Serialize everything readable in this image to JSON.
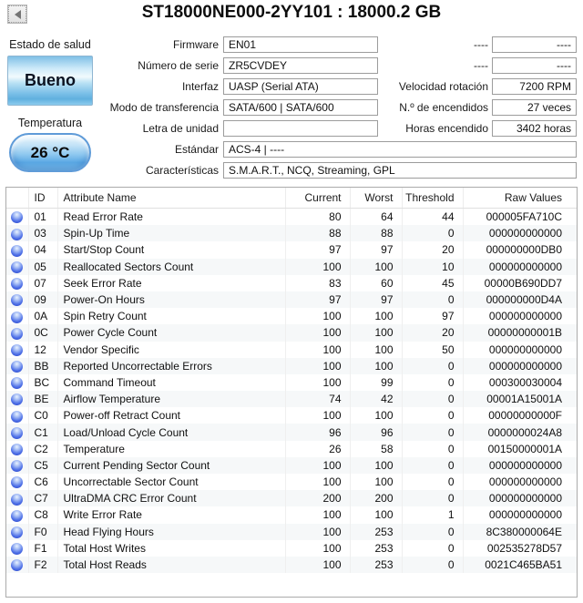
{
  "window": {
    "title": "ST18000NE000-2YY101 : 18000.2 GB",
    "back_icon": "left-triangle"
  },
  "health": {
    "status_label": "Estado de salud",
    "status_value": "Bueno",
    "temperature_label": "Temperatura",
    "temperature_value": "26 °C"
  },
  "fields": {
    "left": [
      {
        "label": "Firmware",
        "value": "EN01",
        "wide": false
      },
      {
        "label": "Número de serie",
        "value": "ZR5CVDEY",
        "wide": false
      },
      {
        "label": "Interfaz",
        "value": "UASP (Serial ATA)",
        "wide": false
      },
      {
        "label": "Modo de transferencia",
        "value": "SATA/600 | SATA/600",
        "wide": false
      },
      {
        "label": "Letra de unidad",
        "value": "",
        "wide": false
      },
      {
        "label": "Estándar",
        "value": "ACS-4 | ----",
        "wide": true
      },
      {
        "label": "Características",
        "value": "S.M.A.R.T., NCQ, Streaming, GPL",
        "wide": true
      }
    ],
    "right": [
      {
        "label": "----",
        "value": "----"
      },
      {
        "label": "----",
        "value": "----"
      },
      {
        "label": "Velocidad rotación",
        "value": "7200 RPM"
      },
      {
        "label": "N.º de encendidos",
        "value": "27 veces"
      },
      {
        "label": "Horas encendido",
        "value": "3402 horas"
      }
    ]
  },
  "smart_table": {
    "status_icon": "blue-dot",
    "status_color": "#4a63de",
    "columns": {
      "id": "ID",
      "name": "Attribute Name",
      "current": "Current",
      "worst": "Worst",
      "threshold": "Threshold",
      "raw": "Raw Values"
    },
    "rows": [
      {
        "id": "01",
        "name": "Read Error Rate",
        "current": "80",
        "worst": "64",
        "threshold": "44",
        "raw": "000005FA710C"
      },
      {
        "id": "03",
        "name": "Spin-Up Time",
        "current": "88",
        "worst": "88",
        "threshold": "0",
        "raw": "000000000000"
      },
      {
        "id": "04",
        "name": "Start/Stop Count",
        "current": "97",
        "worst": "97",
        "threshold": "20",
        "raw": "000000000DB0"
      },
      {
        "id": "05",
        "name": "Reallocated Sectors Count",
        "current": "100",
        "worst": "100",
        "threshold": "10",
        "raw": "000000000000"
      },
      {
        "id": "07",
        "name": "Seek Error Rate",
        "current": "83",
        "worst": "60",
        "threshold": "45",
        "raw": "00000B690DD7"
      },
      {
        "id": "09",
        "name": "Power-On Hours",
        "current": "97",
        "worst": "97",
        "threshold": "0",
        "raw": "000000000D4A"
      },
      {
        "id": "0A",
        "name": "Spin Retry Count",
        "current": "100",
        "worst": "100",
        "threshold": "97",
        "raw": "000000000000"
      },
      {
        "id": "0C",
        "name": "Power Cycle Count",
        "current": "100",
        "worst": "100",
        "threshold": "20",
        "raw": "00000000001B"
      },
      {
        "id": "12",
        "name": "Vendor Specific",
        "current": "100",
        "worst": "100",
        "threshold": "50",
        "raw": "000000000000"
      },
      {
        "id": "BB",
        "name": "Reported Uncorrectable Errors",
        "current": "100",
        "worst": "100",
        "threshold": "0",
        "raw": "000000000000"
      },
      {
        "id": "BC",
        "name": "Command Timeout",
        "current": "100",
        "worst": "99",
        "threshold": "0",
        "raw": "000300030004"
      },
      {
        "id": "BE",
        "name": "Airflow Temperature",
        "current": "74",
        "worst": "42",
        "threshold": "0",
        "raw": "00001A15001A"
      },
      {
        "id": "C0",
        "name": "Power-off Retract Count",
        "current": "100",
        "worst": "100",
        "threshold": "0",
        "raw": "00000000000F"
      },
      {
        "id": "C1",
        "name": "Load/Unload Cycle Count",
        "current": "96",
        "worst": "96",
        "threshold": "0",
        "raw": "0000000024A8"
      },
      {
        "id": "C2",
        "name": "Temperature",
        "current": "26",
        "worst": "58",
        "threshold": "0",
        "raw": "00150000001A"
      },
      {
        "id": "C5",
        "name": "Current Pending Sector Count",
        "current": "100",
        "worst": "100",
        "threshold": "0",
        "raw": "000000000000"
      },
      {
        "id": "C6",
        "name": "Uncorrectable Sector Count",
        "current": "100",
        "worst": "100",
        "threshold": "0",
        "raw": "000000000000"
      },
      {
        "id": "C7",
        "name": "UltraDMA CRC Error Count",
        "current": "200",
        "worst": "200",
        "threshold": "0",
        "raw": "000000000000"
      },
      {
        "id": "C8",
        "name": "Write Error Rate",
        "current": "100",
        "worst": "100",
        "threshold": "1",
        "raw": "000000000000"
      },
      {
        "id": "F0",
        "name": "Head Flying Hours",
        "current": "100",
        "worst": "253",
        "threshold": "0",
        "raw": "8C380000064E"
      },
      {
        "id": "F1",
        "name": "Total Host Writes",
        "current": "100",
        "worst": "253",
        "threshold": "0",
        "raw": "002535278D57"
      },
      {
        "id": "F2",
        "name": "Total Host Reads",
        "current": "100",
        "worst": "253",
        "threshold": "0",
        "raw": "0021C465BA51"
      }
    ]
  },
  "colors": {
    "good_status_blue": "#7fc0e6",
    "temperature_blue": "#5caae5",
    "field_border": "#9c9c9c",
    "table_border": "#ababab",
    "row_stripe": "#f6f8f9"
  }
}
